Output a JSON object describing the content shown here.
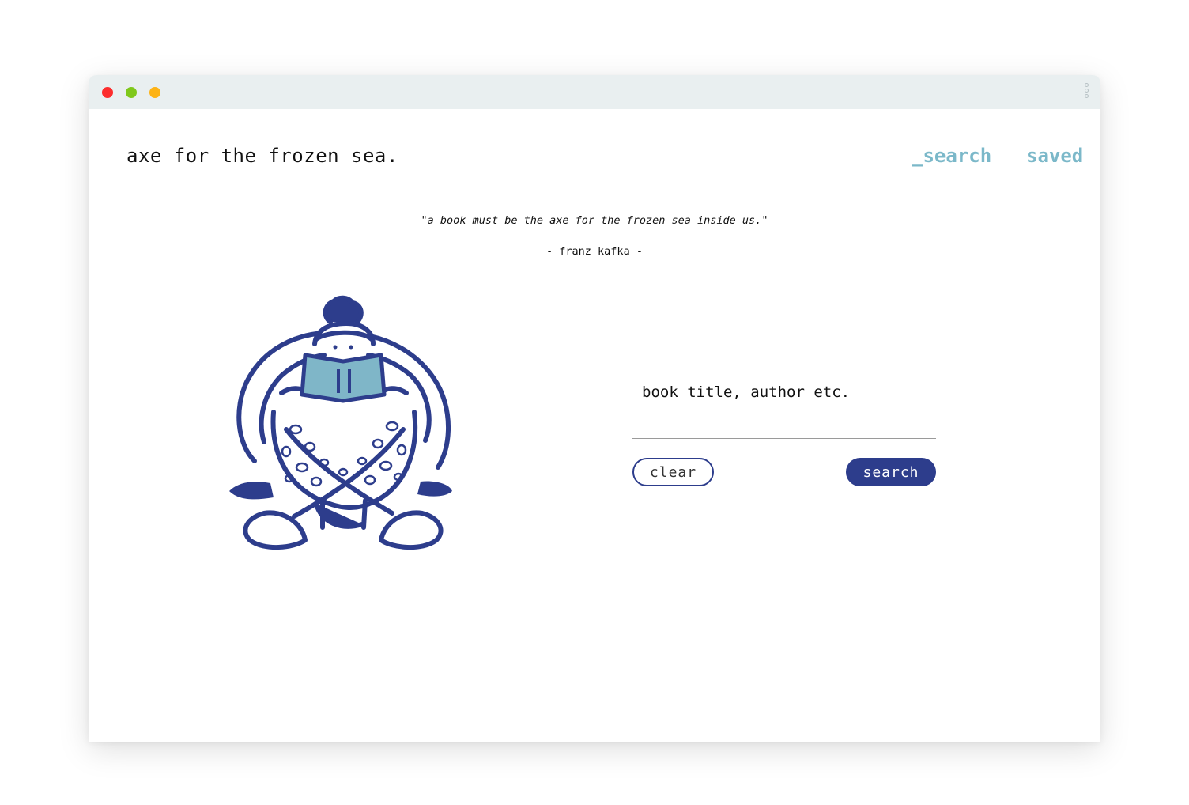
{
  "window": {
    "controls": [
      {
        "name": "close",
        "color": "#fc2d2d"
      },
      {
        "name": "minimize",
        "color": "#7fc81b"
      },
      {
        "name": "zoom",
        "color": "#fdb316"
      }
    ],
    "menu_icon": "kebab-vertical-icon"
  },
  "header": {
    "brand": "axe for the frozen sea.",
    "nav": {
      "search_label": "_search",
      "saved_label": "saved"
    }
  },
  "hero": {
    "quote": "\"a book must be the axe for the frozen sea inside us.\"",
    "attribution": "- franz kafka -"
  },
  "illustration": {
    "name": "person-reading-book-illustration"
  },
  "search": {
    "placeholder": "book title, author etc.",
    "value": "",
    "clear_label": "clear",
    "submit_label": "search"
  },
  "colors": {
    "accent_dark": "#2d3d8c",
    "accent_light": "#7bb8c9",
    "book": "#7fb6c8",
    "titlebar": "#e9eff0"
  }
}
